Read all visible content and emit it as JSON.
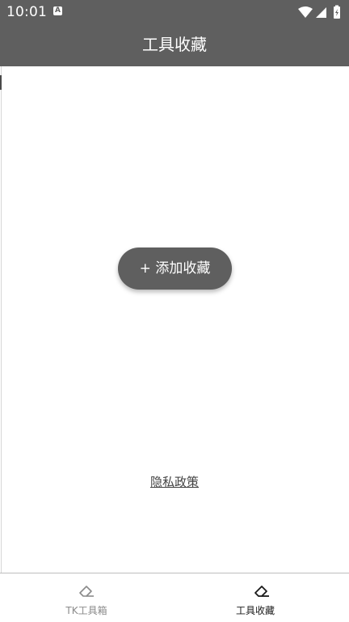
{
  "status_bar": {
    "time": "10:01",
    "notification_icon": "a-badge-icon",
    "system_icons": [
      "wifi-icon",
      "signal-icon",
      "battery-icon"
    ]
  },
  "app_bar": {
    "title": "工具收藏"
  },
  "main": {
    "add_button_label": "+ 添加收藏",
    "privacy_link": "隐私政策"
  },
  "bottom_nav": {
    "items": [
      {
        "label": "TK工具箱",
        "icon": "eraser-icon",
        "active": false
      },
      {
        "label": "工具收藏",
        "icon": "eraser-icon",
        "active": true
      }
    ]
  },
  "colors": {
    "app_bar": "#5f5f5f",
    "button": "#5f5f5f",
    "nav_active": "#1a1a1a",
    "nav_inactive": "#8a8a8a"
  }
}
